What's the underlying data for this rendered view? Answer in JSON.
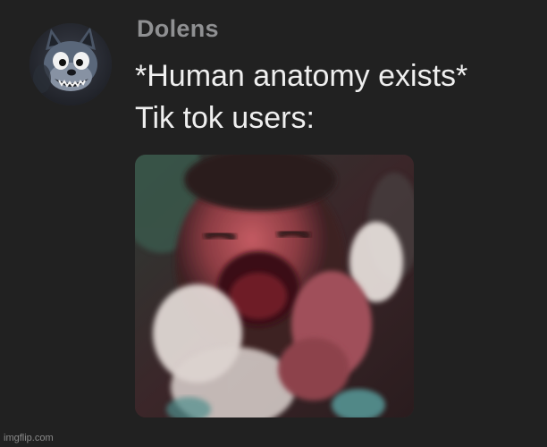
{
  "post": {
    "username": "Dolens",
    "message_lines": [
      "*Human anatomy exists*",
      "Tik tok users:"
    ],
    "avatar_icon": "cartoon-wolf-avatar-icon",
    "attachment_description_icon": "crying-baby-photo"
  },
  "watermark": "imgflip.com",
  "colors": {
    "background": "#212121",
    "username": "#8f9092",
    "message": "#efefef"
  }
}
